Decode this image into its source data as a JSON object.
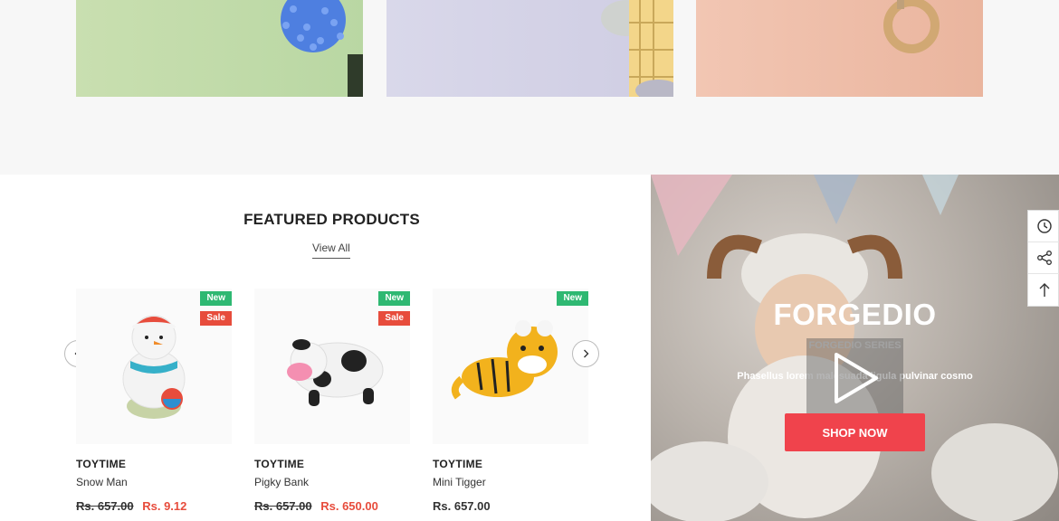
{
  "section": {
    "title": "FEATURED PRODUCTS",
    "view_all": "View All"
  },
  "products": [
    {
      "vendor": "TOYTIME",
      "name": "Snow Man",
      "old_price": "Rs. 657.00",
      "price": "Rs. 9.12",
      "badges": [
        "New",
        "Sale"
      ]
    },
    {
      "vendor": "TOYTIME",
      "name": "Pigky Bank",
      "old_price": "Rs. 657.00",
      "price": "Rs. 650.00",
      "badges": [
        "New",
        "Sale"
      ]
    },
    {
      "vendor": "TOYTIME",
      "name": "Mini Tigger",
      "price": "Rs. 657.00",
      "badges": [
        "New"
      ]
    }
  ],
  "promo": {
    "title": "FORGEDIO",
    "subtitle": "FORGEDIO SERIES",
    "description": "Phasellus lorem malesuada ligula pulvinar cosmo",
    "button": "SHOP NOW"
  },
  "icons": {
    "prev": "chevron-left-icon",
    "next": "chevron-right-icon",
    "play": "play-icon",
    "recent": "history-icon",
    "share": "share-icon",
    "top": "arrow-up-icon"
  },
  "colors": {
    "sale": "#e74c3c",
    "new": "#2eb872",
    "cta": "#f0434c"
  }
}
